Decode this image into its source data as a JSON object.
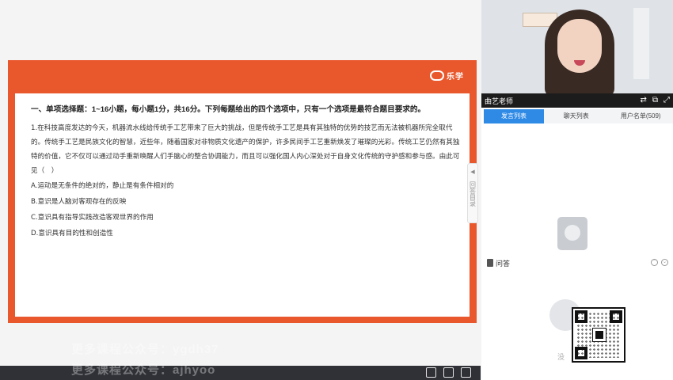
{
  "slide": {
    "logo_text": "乐学",
    "title": "一、单项选择题：1~16小题，每小题1分，共16分。下列每题给出的四个选项中，只有一个选项是最符合题目要求的。",
    "question": "1.在科技高度发达的今天，机器流水线给传统手工艺带来了巨大的挑战，但是传统手工艺是具有其独特的优势的技艺而无法被机器所完全取代的。传统手工艺是民族文化的智慧，近些年，随着国家对非物质文化遗产的保护，许多民间手工艺重新焕发了璀璨的光彩。传统工艺仍然有其独特的价值，它不仅可以通过动手重新唤醒人们手脑心的整合协调能力，而且可以强化国人内心深处对于自身文化传统的守护感和参与感。由此可见（　）",
    "options": [
      "A.运动是无条件的绝对的，静止是有条件相对的",
      "B.意识是人脑对客观存在的反映",
      "C.意识具有指导实践改造客观世界的作用",
      "D.意识具有目的性和创造性"
    ],
    "side_toggle_label": "回答目录",
    "watermark_line1": "更多课程公众号：ygdh37",
    "watermark_line2": "更多课程公众号：ajhyoo"
  },
  "video": {
    "teacher_name": "曲艺老师"
  },
  "tabs": [
    "发言列表",
    "聊天列表",
    "用户名单(509)"
  ],
  "qa": {
    "label": "问答",
    "empty_hint": "没"
  },
  "colors": {
    "slide_frame": "#e9572c",
    "tab_active": "#2f8ae6"
  }
}
